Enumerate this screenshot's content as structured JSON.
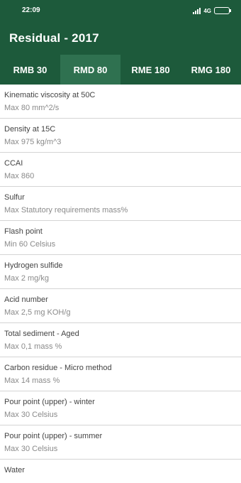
{
  "status_bar": {
    "time": "22:09",
    "network": "4G",
    "icons": [
      "signal-icon",
      "battery-icon"
    ]
  },
  "app_bar": {
    "title": "Residual - 2017"
  },
  "tabs": [
    {
      "label": "RMB 30",
      "active": false
    },
    {
      "label": "RMD 80",
      "active": true
    },
    {
      "label": "RME 180",
      "active": false
    },
    {
      "label": "RMG 180",
      "active": false
    }
  ],
  "items": [
    {
      "label": "Kinematic viscosity at 50C",
      "value": "Max 80 mm^2/s"
    },
    {
      "label": "Density at 15C",
      "value": "Max 975 kg/m^3"
    },
    {
      "label": "CCAI",
      "value": "Max 860"
    },
    {
      "label": "Sulfur",
      "value": "Max Statutory requirements mass%"
    },
    {
      "label": "Flash point",
      "value": "Min 60 Celsius"
    },
    {
      "label": "Hydrogen sulfide",
      "value": "Max 2 mg/kg"
    },
    {
      "label": "Acid number",
      "value": "Max 2,5 mg KOH/g"
    },
    {
      "label": "Total sediment - Aged",
      "value": "Max 0,1 mass %"
    },
    {
      "label": "Carbon residue - Micro method",
      "value": "Max 14 mass %"
    },
    {
      "label": "Pour point (upper) - winter",
      "value": "Max 30 Celsius"
    },
    {
      "label": "Pour point (upper) - summer",
      "value": "Max 30 Celsius"
    },
    {
      "label": "Water",
      "value": ""
    }
  ],
  "colors": {
    "primary": "#1d5a3b",
    "tab_active": "#2f7150",
    "label_text": "#444444",
    "value_text": "#8a8a8a",
    "divider": "#d4d4d4"
  }
}
